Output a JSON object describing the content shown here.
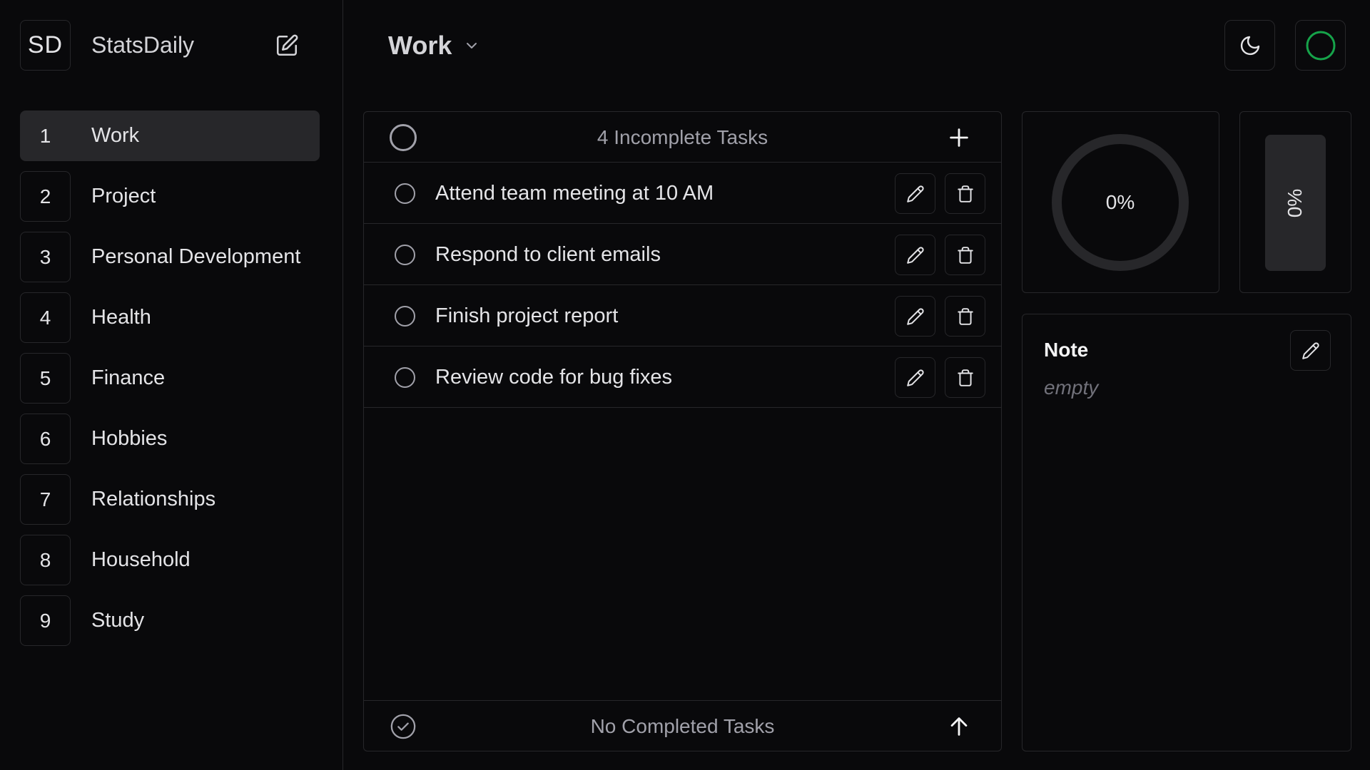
{
  "brand": {
    "logo": "SD",
    "name": "StatsDaily"
  },
  "sidebar": {
    "items": [
      {
        "num": "1",
        "label": "Work",
        "active": true
      },
      {
        "num": "2",
        "label": "Project"
      },
      {
        "num": "3",
        "label": "Personal Development"
      },
      {
        "num": "4",
        "label": "Health"
      },
      {
        "num": "5",
        "label": "Finance"
      },
      {
        "num": "6",
        "label": "Hobbies"
      },
      {
        "num": "7",
        "label": "Relationships"
      },
      {
        "num": "8",
        "label": "Household"
      },
      {
        "num": "9",
        "label": "Study"
      }
    ]
  },
  "header": {
    "title": "Work",
    "theme_icon": "moon-icon",
    "status_icon": "status-circle-icon"
  },
  "tasks": {
    "incomplete_label": "4 Incomplete Tasks",
    "items": [
      {
        "text": "Attend team meeting at 10 AM"
      },
      {
        "text": "Respond to client emails"
      },
      {
        "text": "Finish project report"
      },
      {
        "text": "Review code for bug fixes"
      }
    ],
    "completed_label": "No Completed Tasks"
  },
  "stats": {
    "progress_fraction": 0,
    "ring_label": "0%",
    "bar_label": "0%"
  },
  "note": {
    "title": "Note",
    "body": "empty"
  },
  "colors": {
    "background": "#09090b",
    "border": "#27272a",
    "status_ring": "#16a34a",
    "text_muted": "#a1a1aa"
  }
}
